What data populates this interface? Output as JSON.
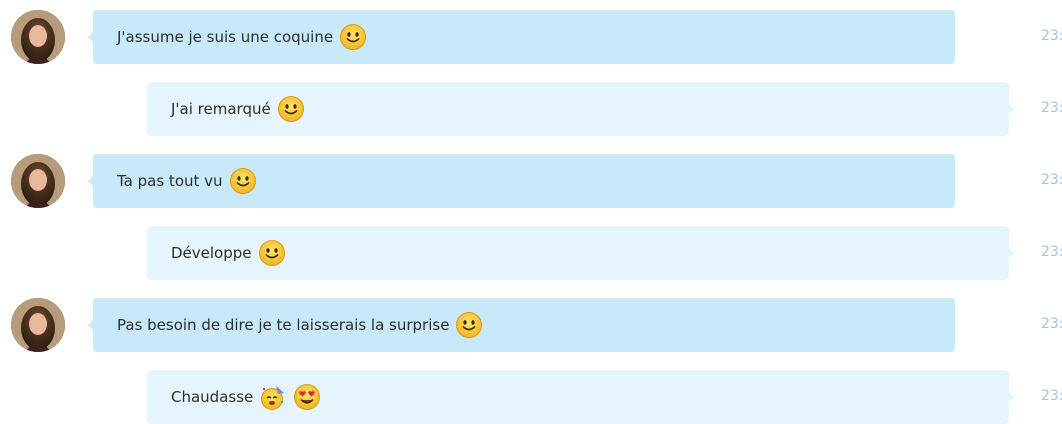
{
  "messages": [
    {
      "text": "J'assume je suis une coquine",
      "time": "23:",
      "side": "in",
      "emoji": [
        "smile-emoji"
      ]
    },
    {
      "text": "J'ai remarqué",
      "time": "23:",
      "side": "out",
      "emoji": [
        "smile-emoji"
      ]
    },
    {
      "text": "Ta pas tout vu",
      "time": "23:",
      "side": "in",
      "emoji": [
        "smile-emoji"
      ]
    },
    {
      "text": "Développe",
      "time": "23:",
      "side": "out",
      "emoji": [
        "smile-emoji"
      ]
    },
    {
      "text": "Pas besoin de dire je te laisserais la surprise",
      "time": "23:",
      "side": "in",
      "emoji": [
        "smile-emoji"
      ]
    },
    {
      "text": "Chaudasse",
      "time": "23:",
      "side": "out",
      "emoji": [
        "party-emoji",
        "heart-eyes-emoji"
      ]
    }
  ],
  "colors": {
    "incoming_bubble": "#c7e9f9",
    "outgoing_bubble": "#e6f5fd",
    "timestamp": "#9fc6d6"
  }
}
